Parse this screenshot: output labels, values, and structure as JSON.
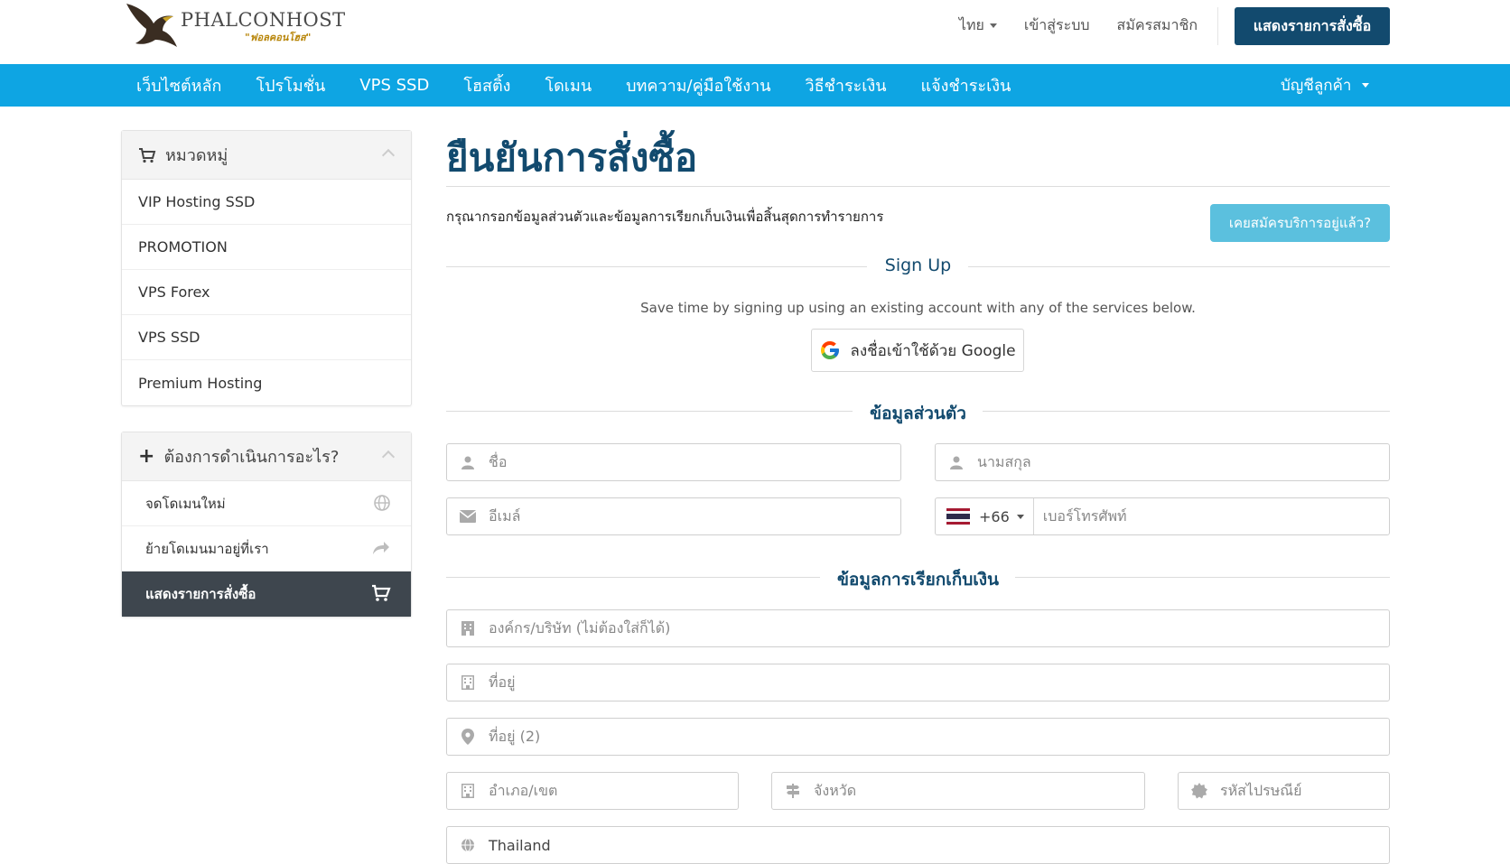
{
  "brand": {
    "name": "PHALCONHOST",
    "tagline": "\"ฟอลคอนโฮส\""
  },
  "top_links": {
    "language": "ไทย",
    "login": "เข้าสู่ระบบ",
    "register": "สมัครสมาชิก"
  },
  "top_cart_button": "แสดงรายการสั่งซื้อ",
  "nav": {
    "items": [
      "เว็บไซต์หลัก",
      "โปรโมชั่น",
      "VPS SSD",
      "โฮสติ้ง",
      "โดเมน",
      "บทความ/คู่มือใช้งาน",
      "วิธีชำระเงิน",
      "แจ้งชำระเงิน"
    ],
    "account": "บัญชีลูกค้า"
  },
  "sidebar": {
    "categories": {
      "title": "หมวดหมู่",
      "items": [
        "VIP Hosting SSD",
        "PROMOTION",
        "VPS Forex",
        "VPS SSD",
        "Premium Hosting"
      ]
    },
    "actions": {
      "title": "ต้องการดำเนินการอะไร?",
      "items": [
        {
          "label": "จดโดเมนใหม่",
          "icon": "globe-icon"
        },
        {
          "label": "ย้ายโดเมนมาอยู่ที่เรา",
          "icon": "share-arrow-icon"
        },
        {
          "label": "แสดงรายการสั่งซื้อ",
          "icon": "cart-icon",
          "active": true
        }
      ]
    }
  },
  "main": {
    "title": "ยืนยันการสั่งซื้อ",
    "subtitle": "กรุณากรอกข้อมูลส่วนตัวและข้อมูลการเรียกเก็บเงินเพื่อสิ้นสุดการทำรายการ",
    "existing_button": "เคยสมัครบริการอยู่แล้ว?",
    "signup": {
      "heading": "Sign Up",
      "note": "Save time by signing up using an existing account with any of the services below.",
      "google_button": "ลงชื่อเข้าใช้ด้วย Google"
    },
    "personal": {
      "heading": "ข้อมูลส่วนตัว",
      "first_name": "ชื่อ",
      "last_name": "นามสกุล",
      "email": "อีเมล์",
      "phone_code": "+66",
      "phone": "เบอร์โทรศัพท์"
    },
    "billing": {
      "heading": "ข้อมูลการเรียกเก็บเงิน",
      "company": "องค์กร/บริษัท (ไม่ต้องใส่ก็ได้)",
      "address1": "ที่อยู่",
      "address2": "ที่อยู่ (2)",
      "city": "อำเภอ/เขต",
      "state": "จังหวัด",
      "postcode": "รหัสไปรษณีย์",
      "country": "Thailand"
    }
  },
  "colors": {
    "primary": "#124a6e",
    "nav": "#0ea5e3",
    "info": "#5bc0de",
    "sidebar_active": "#3e464e"
  }
}
